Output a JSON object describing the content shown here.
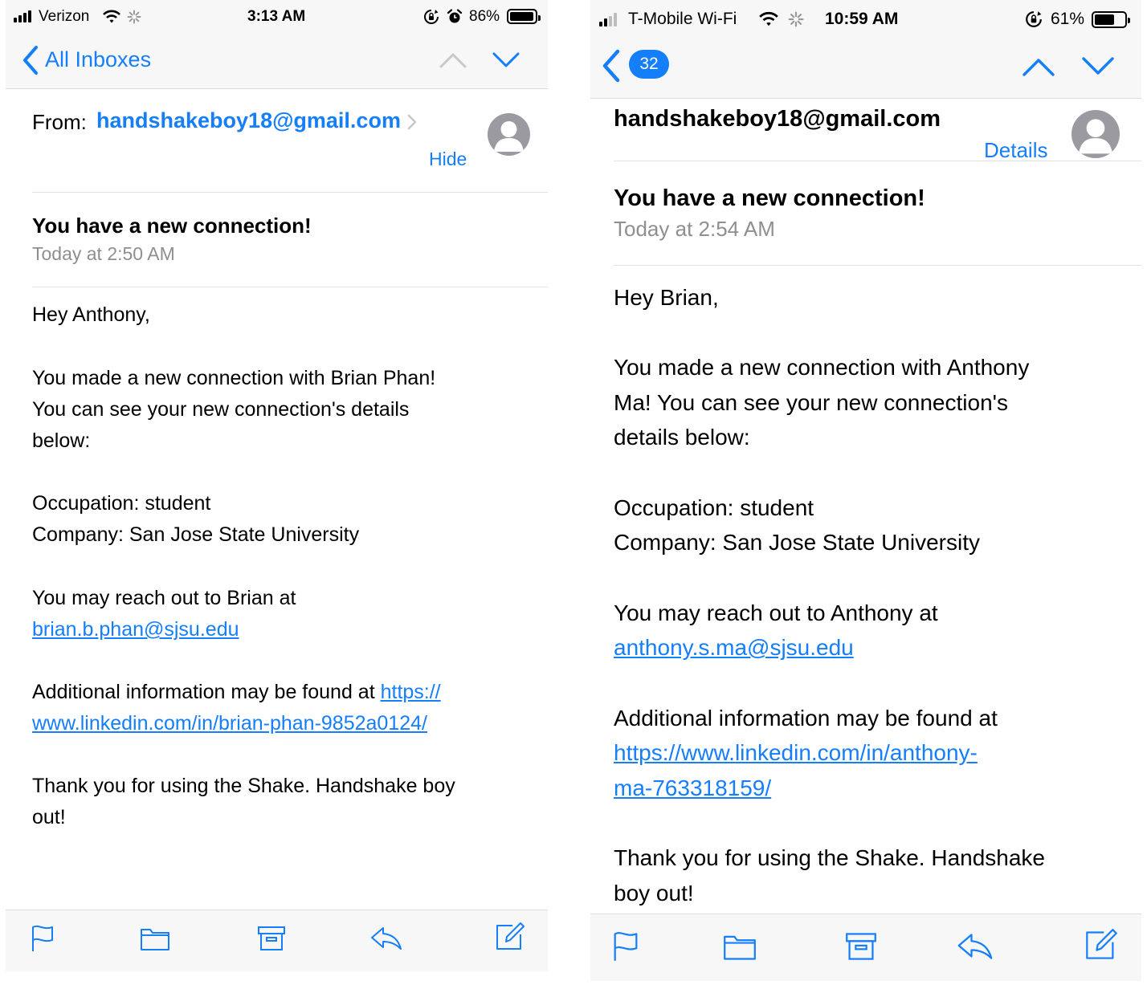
{
  "left": {
    "status": {
      "carrier": "Verizon",
      "time": "3:13 AM",
      "battery": "86%",
      "battery_level": 0.86
    },
    "nav": {
      "back_label": "All Inboxes"
    },
    "header": {
      "from_label": "From:",
      "from_email": "handshakeboy18@gmail.com",
      "toggle_label": "Hide",
      "subject": "You have a new connection!",
      "date": "Today at 2:50 AM"
    },
    "body": {
      "greeting": "Hey Anthony,",
      "para1_line1": "You made a new connection with Brian Phan!",
      "para1_line2": "You can see your new connection's details",
      "para1_line3": "below:",
      "occupation": "Occupation: student",
      "company": "Company: San Jose State University",
      "reach_text": "You may reach out to Brian at",
      "reach_email": "brian.b.phan@sjsu.edu",
      "info_text": "Additional information may be found at ",
      "info_link_part1": "https://",
      "info_link_part2": "www.linkedin.com/in/brian-phan-9852a0124/",
      "closing_line1": "Thank you for using the Shake. Handshake boy",
      "closing_line2": "out!"
    }
  },
  "right": {
    "status": {
      "carrier": "T-Mobile Wi-Fi",
      "time": "10:59 AM",
      "battery": "61%",
      "battery_level": 0.61
    },
    "nav": {
      "back_badge": "32"
    },
    "header": {
      "from_email": "handshakeboy18@gmail.com",
      "toggle_label": "Details",
      "subject": "You have a new connection!",
      "date": "Today at 2:54 AM"
    },
    "body": {
      "greeting": "Hey Brian,",
      "para1_line1": "You made a new connection with Anthony",
      "para1_line2": "Ma! You can see your new connection's",
      "para1_line3": "details below:",
      "occupation": "Occupation: student",
      "company": "Company: San Jose State University",
      "reach_text": "You may reach out to Anthony at",
      "reach_email": "anthony.s.ma@sjsu.edu",
      "info_text": "Additional information may be found at",
      "info_link_line1": "https://www.linkedin.com/in/anthony-",
      "info_link_line2": "ma-763318159/",
      "closing_line1": "Thank you for using the Shake. Handshake",
      "closing_line2": "boy out!"
    }
  },
  "colors": {
    "accent": "#147efb",
    "secondary_text": "#8e8e93",
    "bar_background": "#f7f7f8"
  },
  "icons": [
    "signal-icon",
    "wifi-icon",
    "activity-spinner-icon",
    "orientation-lock-icon",
    "alarm-icon",
    "battery-icon",
    "back-chevron-icon",
    "chevron-up-icon",
    "chevron-down-icon",
    "avatar-icon",
    "flag-icon",
    "folder-icon",
    "archive-icon",
    "reply-icon",
    "compose-icon"
  ]
}
